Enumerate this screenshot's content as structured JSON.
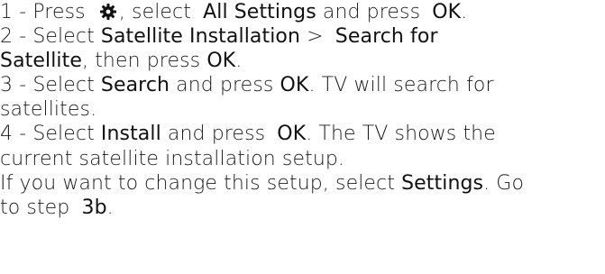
{
  "step1": {
    "prefix": "1 -  Press ",
    "icon": "gear-icon",
    "mid": ", select ",
    "target": "All Settings",
    "tail": " and press ",
    "ok": "OK",
    "end": "."
  },
  "step2": {
    "prefix": "2 -  Select ",
    "target": "Satellite Installation",
    "sep": " > ",
    "target2a": "Search for",
    "target2b": "Satellite",
    "tail": ", then press ",
    "ok": "OK",
    "end": "."
  },
  "step3": {
    "prefix": "3 -  Select ",
    "target": "Search",
    "tail": " and press ",
    "ok": "OK",
    "rest": ". TV will search for",
    "rest2": "satellites."
  },
  "step4": {
    "prefix": "4 -  Select ",
    "target": "Install",
    "tail": " and press ",
    "ok": "OK",
    "rest": ". The TV shows the",
    "rest2": "current satellite installation setup."
  },
  "note": {
    "text": "If you want to change this setup, select ",
    "target": "Settings",
    "rest": ". Go",
    "line2": "to step ",
    "step": "3b",
    "end": "."
  }
}
